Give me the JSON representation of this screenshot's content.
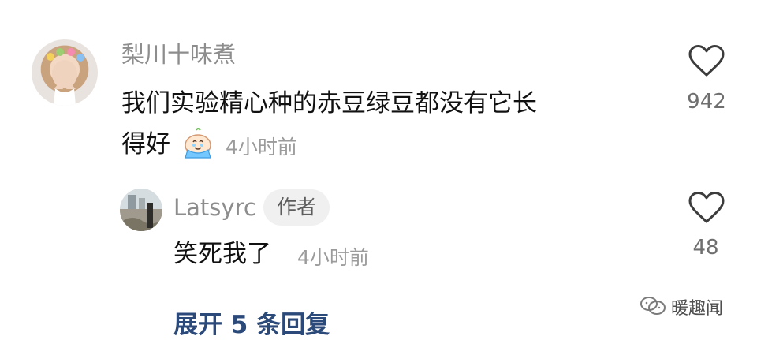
{
  "comments": [
    {
      "username": "梨川十味煮",
      "text_line1": "我们实验精心种的赤豆绿豆都没有它长",
      "text_line2": "得好",
      "emoji": "crying-sticker",
      "time": "4小时前",
      "likes": "942"
    }
  ],
  "reply": {
    "username": "Latsyrc",
    "badge": "作者",
    "text": "笑死我了",
    "time": "4小时前",
    "likes": "48"
  },
  "expand_label": "展开 5 条回复",
  "watermark": "暖趣闻",
  "colors": {
    "link": "#2b4a7a",
    "muted": "#8d8d8d",
    "text": "#111111"
  }
}
